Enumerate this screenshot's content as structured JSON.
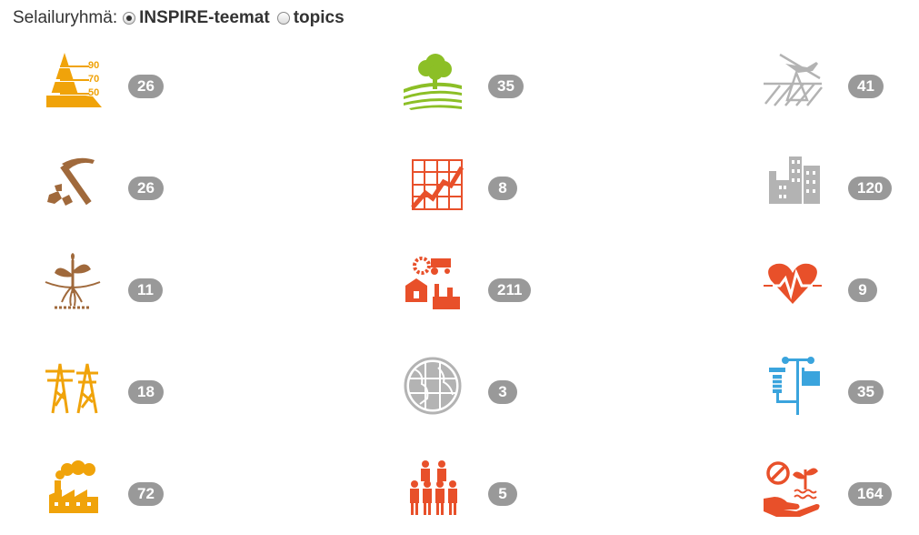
{
  "browse_group": {
    "label": "Selailuryhmä:",
    "options": [
      {
        "label": "INSPIRE-teemat",
        "selected": true
      },
      {
        "label": "topics",
        "selected": false
      }
    ]
  },
  "themes": [
    {
      "icon": "elevation-contour-icon",
      "count": "26",
      "color": "#f0a30a"
    },
    {
      "icon": "land-cover-tree-icon",
      "count": "35",
      "color": "#8cbf26"
    },
    {
      "icon": "orthoimagery-plane-icon",
      "count": "41",
      "color": "#b3b3b3"
    },
    {
      "icon": "geology-hammer-icon",
      "count": "26",
      "color": "#a0693b"
    },
    {
      "icon": "statistics-chart-icon",
      "count": "8",
      "color": "#e8502a"
    },
    {
      "icon": "buildings-icon",
      "count": "120",
      "color": "#b3b3b3"
    },
    {
      "icon": "soil-plant-roots-icon",
      "count": "11",
      "color": "#a0693b"
    },
    {
      "icon": "land-use-tractor-factory-icon",
      "count": "211",
      "color": "#e8502a"
    },
    {
      "icon": "human-health-heart-icon",
      "count": "9",
      "color": "#e8502a"
    },
    {
      "icon": "utility-power-towers-icon",
      "count": "18",
      "color": "#f0a30a"
    },
    {
      "icon": "globe-grid-icon",
      "count": "3",
      "color": "#b3b3b3"
    },
    {
      "icon": "meteorological-station-icon",
      "count": "35",
      "color": "#3aa4dd"
    },
    {
      "icon": "industrial-factory-smoke-icon",
      "count": "72",
      "color": "#f0a30a"
    },
    {
      "icon": "population-people-icon",
      "count": "5",
      "color": "#e8502a"
    },
    {
      "icon": "protected-area-hand-icon",
      "count": "164",
      "color": "#e8502a"
    }
  ]
}
